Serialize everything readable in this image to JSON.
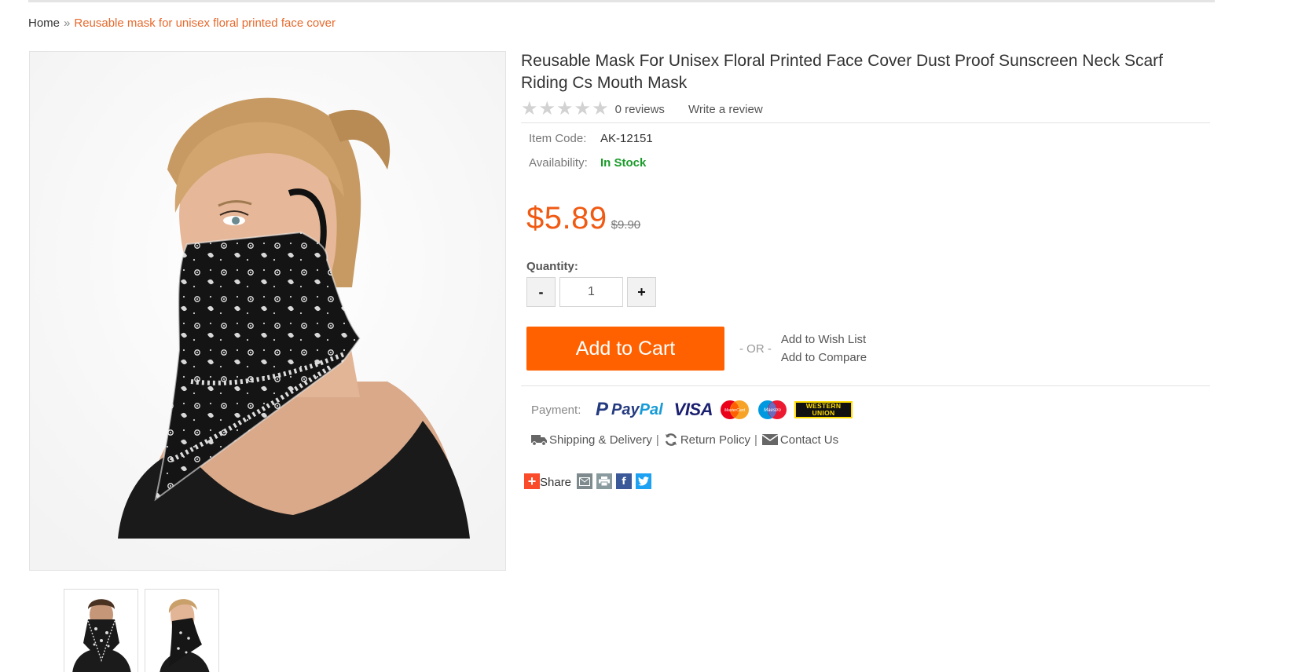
{
  "breadcrumb": {
    "home": "Home",
    "separator": "»",
    "current": "Reusable mask for unisex floral printed face cover"
  },
  "product": {
    "title": "Reusable Mask For Unisex Floral Printed Face Cover Dust Proof Sunscreen Neck Scarf Riding Cs Mouth Mask",
    "rating": {
      "stars_filled": 0,
      "stars_total": 5
    },
    "reviews_label": "0 reviews",
    "write_review_label": "Write a review",
    "item_code_label": "Item Code:",
    "item_code": "AK-12151",
    "availability_label": "Availability:",
    "availability": "In Stock",
    "price": "$5.89",
    "old_price": "$9.90",
    "quantity_label": "Quantity:",
    "quantity_value": "1",
    "minus_label": "-",
    "plus_label": "+",
    "add_to_cart_label": "Add to Cart",
    "or_label": "- OR -",
    "wishlist_label": "Add to Wish List",
    "compare_label": "Add to Compare"
  },
  "payment": {
    "label": "Payment:",
    "paypal_p": "P",
    "paypal_pay": "Pay",
    "paypal_pal": "Pal",
    "visa": "VISA",
    "mastercard": "MasterCard",
    "maestro": "Maestro",
    "western_union_1": "WESTERN",
    "western_union_2": "UNION"
  },
  "policies": {
    "shipping": "Shipping & Delivery",
    "returns": "Return Policy",
    "contact": "Contact Us",
    "separator": "|"
  },
  "share": {
    "label": "Share",
    "plus": "+",
    "facebook": "f"
  },
  "images": {
    "thumbnails": [
      "thumb-front-man",
      "thumb-side-woman"
    ]
  },
  "colors": {
    "accent_orange": "#ff6100",
    "price_orange": "#f05a12",
    "breadcrumb_orange": "#e8692c",
    "in_stock_green": "#1a9b2a"
  }
}
